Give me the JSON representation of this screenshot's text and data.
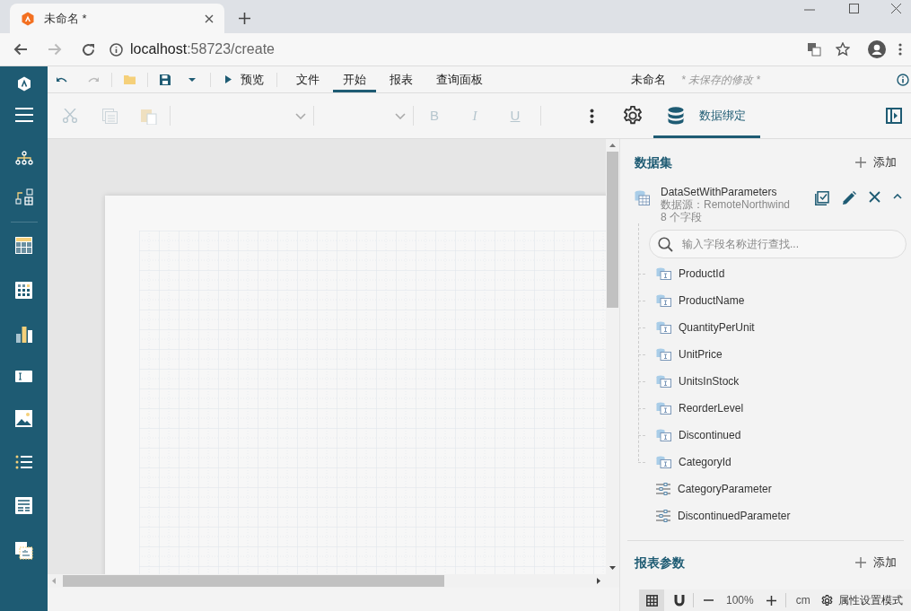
{
  "browser": {
    "tab_title": "未命名 *",
    "url_host": "localhost",
    "url_rest": ":58723/create"
  },
  "toolbar": {
    "preview": "预览",
    "tabs": [
      {
        "label": "文件",
        "selected": false
      },
      {
        "label": "开始",
        "selected": true
      },
      {
        "label": "报表",
        "selected": false
      },
      {
        "label": "查询面板",
        "selected": false
      }
    ],
    "document_name": "未命名",
    "unsaved": "* 未保存的修改 *"
  },
  "format_bar": {
    "bold": "B",
    "italic": "I",
    "underline": "U"
  },
  "panel": {
    "tabs": [
      {
        "kind": "settings",
        "selected": false
      },
      {
        "kind": "data",
        "label": "数据绑定",
        "selected": true
      }
    ],
    "datasets_title": "数据集",
    "add": "添加",
    "dataset": {
      "name": "DataSetWithParameters",
      "source": "数据源：RemoteNorthwind",
      "field_count": "8 个字段",
      "expanded": true
    },
    "search": {
      "placeholder": "输入字段名称进行查找..."
    },
    "fields": [
      {
        "kind": "field",
        "name": "ProductId"
      },
      {
        "kind": "field",
        "name": "ProductName"
      },
      {
        "kind": "field",
        "name": "QuantityPerUnit"
      },
      {
        "kind": "field",
        "name": "UnitPrice"
      },
      {
        "kind": "field",
        "name": "UnitsInStock"
      },
      {
        "kind": "field",
        "name": "ReorderLevel"
      },
      {
        "kind": "field",
        "name": "Discontinued"
      },
      {
        "kind": "field",
        "name": "CategoryId"
      },
      {
        "kind": "parameter",
        "name": "CategoryParameter"
      },
      {
        "kind": "parameter",
        "name": "DiscontinuedParameter"
      }
    ],
    "params_title": "报表参数",
    "params_add": "添加"
  },
  "status_bar": {
    "zoom": "100%",
    "unit": "cm",
    "mode": "属性设置模式",
    "grid_on": true
  }
}
